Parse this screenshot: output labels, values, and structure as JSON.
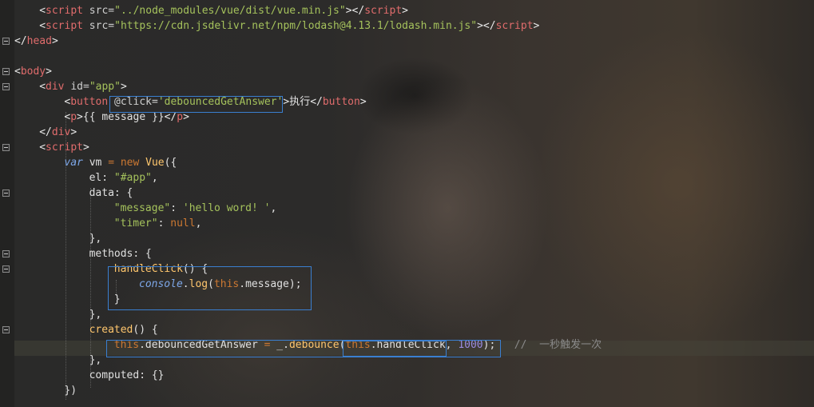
{
  "editor": {
    "lines": [
      {
        "id": "l0",
        "indent": 2,
        "parts": [
          {
            "c": "ang",
            "t": "<"
          },
          {
            "c": "tag",
            "t": "script"
          },
          {
            "c": "attr",
            "t": " src="
          },
          {
            "c": "str",
            "t": "\"../node_modules/vue/dist/vue.min.js\""
          },
          {
            "c": "ang",
            "t": "></"
          },
          {
            "c": "tag",
            "t": "script"
          },
          {
            "c": "ang",
            "t": ">"
          }
        ]
      },
      {
        "id": "l1",
        "indent": 2,
        "parts": [
          {
            "c": "ang",
            "t": "<"
          },
          {
            "c": "tag",
            "t": "script"
          },
          {
            "c": "attr",
            "t": " src="
          },
          {
            "c": "str",
            "t": "\"https://cdn.jsdelivr.net/npm/lodash@4.13.1/lodash.min.js\""
          },
          {
            "c": "ang",
            "t": "></"
          },
          {
            "c": "tag",
            "t": "script"
          },
          {
            "c": "ang",
            "t": ">"
          }
        ]
      },
      {
        "id": "l2",
        "indent": 0,
        "parts": [
          {
            "c": "ang",
            "t": "</"
          },
          {
            "c": "tag",
            "t": "head"
          },
          {
            "c": "ang",
            "t": ">"
          }
        ]
      },
      {
        "id": "l3",
        "indent": 0,
        "parts": []
      },
      {
        "id": "l4",
        "indent": 0,
        "parts": [
          {
            "c": "ang",
            "t": "<"
          },
          {
            "c": "tag",
            "t": "body"
          },
          {
            "c": "ang",
            "t": ">"
          }
        ]
      },
      {
        "id": "l5",
        "indent": 2,
        "parts": [
          {
            "c": "ang",
            "t": "<"
          },
          {
            "c": "tag",
            "t": "div"
          },
          {
            "c": "attr",
            "t": " id="
          },
          {
            "c": "str",
            "t": "\"app\""
          },
          {
            "c": "ang",
            "t": ">"
          }
        ]
      },
      {
        "id": "l6",
        "indent": 4,
        "parts": [
          {
            "c": "ang",
            "t": "<"
          },
          {
            "c": "tag",
            "t": "button"
          },
          {
            "c": "attr",
            "t": " @click="
          },
          {
            "c": "str",
            "t": "'debouncedGetAnswer'"
          },
          {
            "c": "ang",
            "t": ">"
          },
          {
            "c": "cn",
            "t": "执行"
          },
          {
            "c": "ang",
            "t": "</"
          },
          {
            "c": "tag",
            "t": "button"
          },
          {
            "c": "ang",
            "t": ">"
          }
        ]
      },
      {
        "id": "l7",
        "indent": 4,
        "parts": [
          {
            "c": "ang",
            "t": "<"
          },
          {
            "c": "tag",
            "t": "p"
          },
          {
            "c": "ang",
            "t": ">"
          },
          {
            "c": "plain",
            "t": "{{ message }}"
          },
          {
            "c": "ang",
            "t": "</"
          },
          {
            "c": "tag",
            "t": "p"
          },
          {
            "c": "ang",
            "t": ">"
          }
        ]
      },
      {
        "id": "l8",
        "indent": 2,
        "parts": [
          {
            "c": "ang",
            "t": "</"
          },
          {
            "c": "tag",
            "t": "div"
          },
          {
            "c": "ang",
            "t": ">"
          }
        ]
      },
      {
        "id": "l9",
        "indent": 2,
        "parts": [
          {
            "c": "ang",
            "t": "<"
          },
          {
            "c": "tag",
            "t": "script"
          },
          {
            "c": "ang",
            "t": ">"
          }
        ]
      },
      {
        "id": "l10",
        "indent": 4,
        "parts": [
          {
            "c": "kwi",
            "t": "var"
          },
          {
            "c": "plain",
            "t": " vm "
          },
          {
            "c": "kw",
            "t": "="
          },
          {
            "c": "kw",
            "t": " new"
          },
          {
            "c": "plain",
            "t": " "
          },
          {
            "c": "fn",
            "t": "Vue"
          },
          {
            "c": "plain",
            "t": "({"
          }
        ]
      },
      {
        "id": "l11",
        "indent": 6,
        "parts": [
          {
            "c": "plain",
            "t": "el: "
          },
          {
            "c": "str",
            "t": "\"#app\""
          },
          {
            "c": "plain",
            "t": ","
          }
        ]
      },
      {
        "id": "l12",
        "indent": 6,
        "parts": [
          {
            "c": "plain",
            "t": "data: {"
          }
        ]
      },
      {
        "id": "l13",
        "indent": 8,
        "parts": [
          {
            "c": "str",
            "t": "\"message\""
          },
          {
            "c": "plain",
            "t": ": "
          },
          {
            "c": "str",
            "t": "'hello word! '"
          },
          {
            "c": "plain",
            "t": ","
          }
        ]
      },
      {
        "id": "l14",
        "indent": 8,
        "parts": [
          {
            "c": "str",
            "t": "\"timer\""
          },
          {
            "c": "plain",
            "t": ": "
          },
          {
            "c": "kw",
            "t": "null"
          },
          {
            "c": "plain",
            "t": ","
          }
        ]
      },
      {
        "id": "l15",
        "indent": 6,
        "parts": [
          {
            "c": "plain",
            "t": "},"
          }
        ]
      },
      {
        "id": "l16",
        "indent": 6,
        "parts": [
          {
            "c": "plain",
            "t": "methods: {"
          }
        ]
      },
      {
        "id": "l17",
        "indent": 8,
        "parts": [
          {
            "c": "fn",
            "t": "handleClick"
          },
          {
            "c": "plain",
            "t": "() {"
          }
        ]
      },
      {
        "id": "l18",
        "indent": 10,
        "parts": [
          {
            "c": "ital",
            "t": "console"
          },
          {
            "c": "plain",
            "t": "."
          },
          {
            "c": "fn",
            "t": "log"
          },
          {
            "c": "plain",
            "t": "("
          },
          {
            "c": "this",
            "t": "this"
          },
          {
            "c": "plain",
            "t": ".message);"
          }
        ]
      },
      {
        "id": "l19",
        "indent": 8,
        "parts": [
          {
            "c": "plain",
            "t": "}"
          }
        ]
      },
      {
        "id": "l20",
        "indent": 6,
        "parts": [
          {
            "c": "plain",
            "t": "},"
          }
        ]
      },
      {
        "id": "l21",
        "indent": 6,
        "parts": [
          {
            "c": "fn",
            "t": "created"
          },
          {
            "c": "plain",
            "t": "() {"
          }
        ]
      },
      {
        "id": "l22",
        "indent": 8,
        "parts": [
          {
            "c": "this",
            "t": "this"
          },
          {
            "c": "plain",
            "t": ".debouncedGetAnswer "
          },
          {
            "c": "kw",
            "t": "="
          },
          {
            "c": "plain",
            "t": " _."
          },
          {
            "c": "fn",
            "t": "debounce"
          },
          {
            "c": "plain",
            "t": "("
          },
          {
            "c": "this",
            "t": "this"
          },
          {
            "c": "plain",
            "t": ".handleClick, "
          },
          {
            "c": "num",
            "t": "1000"
          },
          {
            "c": "plain",
            "t": ");   "
          },
          {
            "c": "cmt",
            "t": "//  "
          },
          {
            "c": "cmtcn",
            "t": "一秒触发一次"
          }
        ]
      },
      {
        "id": "l23",
        "indent": 6,
        "parts": [
          {
            "c": "plain",
            "t": "},"
          }
        ]
      },
      {
        "id": "l24",
        "indent": 6,
        "parts": [
          {
            "c": "plain",
            "t": "computed: {}"
          }
        ]
      },
      {
        "id": "l25",
        "indent": 4,
        "parts": [
          {
            "c": "plain",
            "t": "})"
          }
        ]
      }
    ],
    "folds": [
      2,
      4,
      5,
      9,
      12,
      16,
      17,
      21
    ]
  }
}
